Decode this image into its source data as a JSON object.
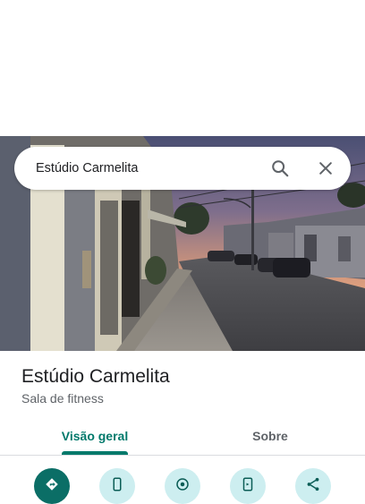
{
  "search": {
    "query": "Estúdio Carmelita",
    "search_icon": "search-icon",
    "close_icon": "close-icon"
  },
  "place": {
    "name": "Estúdio Carmelita",
    "category": "Sala de fitness"
  },
  "tabs": [
    {
      "label": "Visão geral",
      "selected": true
    },
    {
      "label": "Sobre",
      "selected": false
    }
  ],
  "actions": [
    {
      "icon": "directions-icon",
      "style": "primary"
    },
    {
      "icon": "phone-icon",
      "style": "secondary"
    },
    {
      "icon": "nearby-icon",
      "style": "secondary"
    },
    {
      "icon": "send-to-phone-icon",
      "style": "secondary"
    },
    {
      "icon": "share-icon",
      "style": "secondary"
    }
  ],
  "colors": {
    "accent": "#00796b",
    "primary_action": "#0b6e66",
    "secondary_action": "#cdeef0"
  }
}
